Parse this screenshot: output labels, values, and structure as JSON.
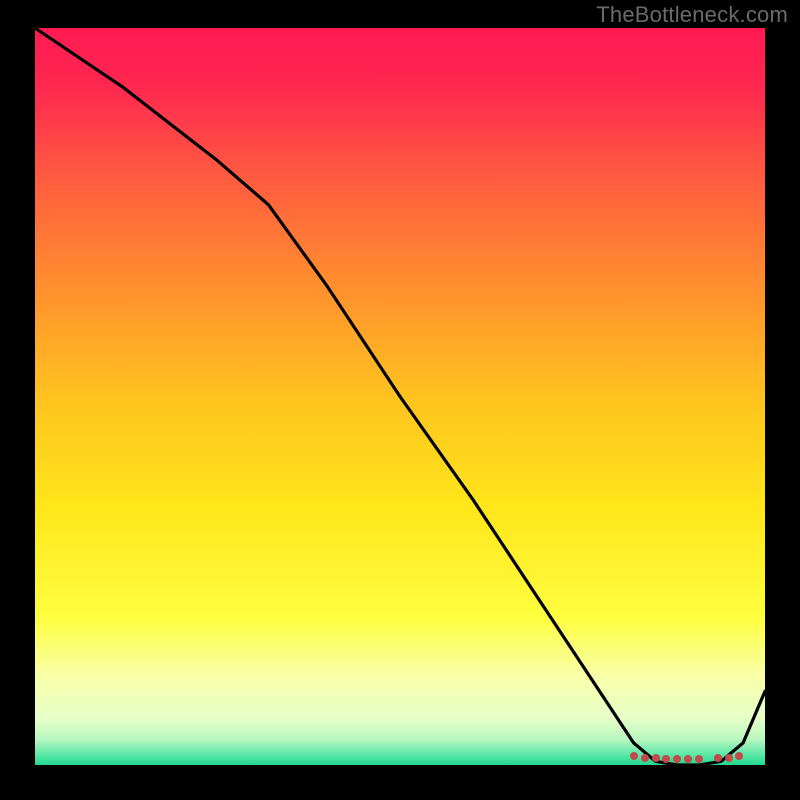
{
  "watermark": "TheBottleneck.com",
  "chart_data": {
    "type": "line",
    "title": "",
    "xlabel": "",
    "ylabel": "",
    "xlim": [
      0,
      100
    ],
    "ylim": [
      0,
      100
    ],
    "grid": false,
    "legend": false,
    "series": [
      {
        "name": "curve",
        "color": "#000000",
        "x": [
          0,
          12,
          25,
          32,
          40,
          50,
          60,
          70,
          78,
          82,
          85,
          88,
          91,
          94,
          97,
          100
        ],
        "values": [
          100,
          92,
          82,
          76,
          65,
          50,
          36,
          21,
          9,
          3,
          0.5,
          0,
          0,
          0.5,
          3,
          10
        ]
      }
    ],
    "markers": {
      "name": "bottom-dots",
      "color": "#C24A4A",
      "x": [
        82,
        83.5,
        85,
        86.5,
        88,
        89.5,
        91,
        93.5,
        95,
        96.5
      ],
      "values": [
        1.2,
        1.0,
        0.9,
        0.8,
        0.8,
        0.8,
        0.8,
        0.9,
        1.0,
        1.2
      ]
    },
    "background_gradient": {
      "stops": [
        {
          "offset": 0.0,
          "color": "#FF1A52"
        },
        {
          "offset": 0.08,
          "color": "#FF2850"
        },
        {
          "offset": 0.2,
          "color": "#FF5A40"
        },
        {
          "offset": 0.35,
          "color": "#FF8F2E"
        },
        {
          "offset": 0.5,
          "color": "#FFC21F"
        },
        {
          "offset": 0.65,
          "color": "#FFE61A"
        },
        {
          "offset": 0.8,
          "color": "#FEFE40"
        },
        {
          "offset": 0.88,
          "color": "#F8FFA8"
        },
        {
          "offset": 0.935,
          "color": "#E8FFC8"
        },
        {
          "offset": 0.965,
          "color": "#B8F7C0"
        },
        {
          "offset": 0.985,
          "color": "#5FE8A8"
        },
        {
          "offset": 1.0,
          "color": "#22D88F"
        }
      ]
    }
  }
}
